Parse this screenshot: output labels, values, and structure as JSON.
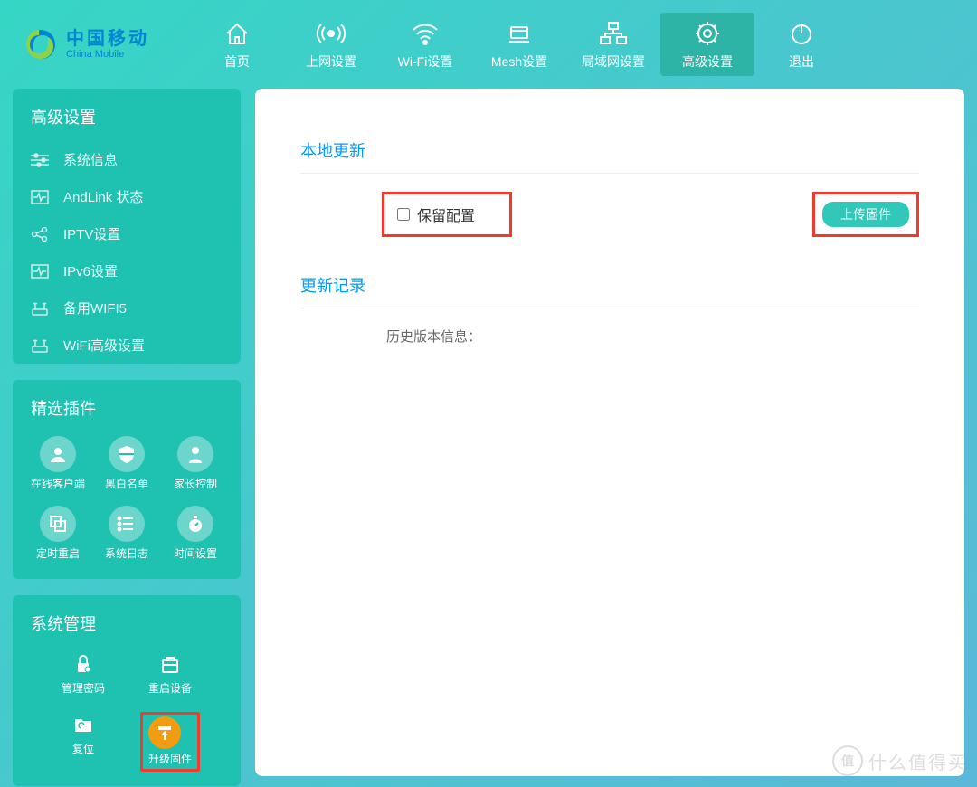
{
  "brand": {
    "cn": "中国移动",
    "en": "China Mobile"
  },
  "topnav": {
    "home": "首页",
    "internet": "上网设置",
    "wifi": "Wi-Fi设置",
    "mesh": "Mesh设置",
    "lan": "局域网设置",
    "advanced": "高级设置",
    "logout": "退出"
  },
  "sidebar": {
    "advanced_title": "高级设置",
    "items": {
      "sysinfo": "系统信息",
      "andlink": "AndLink 状态",
      "iptv": "IPTV设置",
      "ipv6": "IPv6设置",
      "wifi5": "备用WIFI5",
      "wifiadv": "WiFi高级设置"
    },
    "plugins_title": "精选插件",
    "plugins": {
      "clients": "在线客户端",
      "blacklist": "黑白名单",
      "parental": "家长控制",
      "schedule": "定时重启",
      "syslog": "系统日志",
      "time": "时间设置"
    },
    "mgmt_title": "系统管理",
    "mgmt": {
      "password": "管理密码",
      "reboot": "重启设备",
      "reset": "复位",
      "upgrade": "升级固件"
    }
  },
  "main": {
    "local_update": "本地更新",
    "keep_config": "保留配置",
    "upload_btn": "上传固件",
    "history_title": "更新记录",
    "history_label": "历史版本信息："
  },
  "watermark": {
    "badge": "值",
    "text": "什么值得买"
  }
}
